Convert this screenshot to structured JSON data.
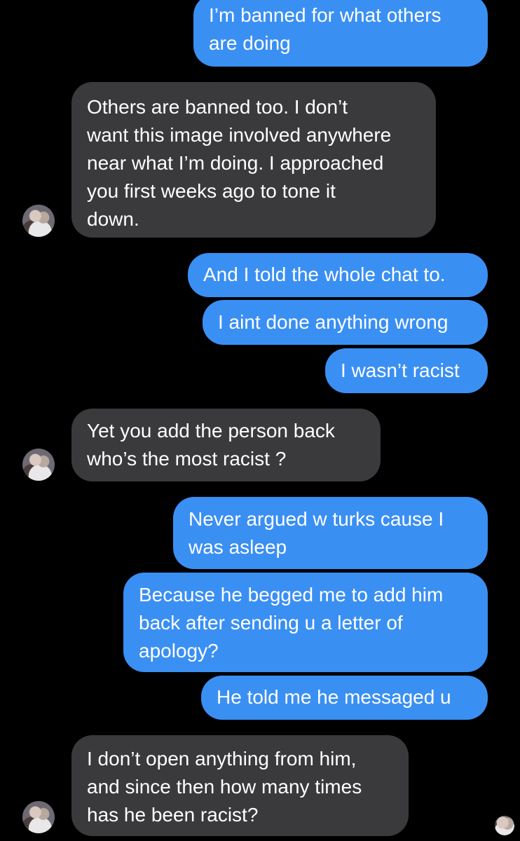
{
  "messages": [
    {
      "from": "me",
      "text": "I’m banned for what others\nare doing"
    },
    {
      "from": "them",
      "text": "Others are banned too. I don’t\nwant this image involved anywhere\nnear what I’m doing. I approached\nyou first weeks ago to tone it\ndown."
    },
    {
      "from": "me",
      "text": "And I told the whole chat to."
    },
    {
      "from": "me",
      "text": "I aint done anything wrong"
    },
    {
      "from": "me",
      "text": "I wasn’t racist"
    },
    {
      "from": "them",
      "text": "Yet you add the person back\nwho’s the most racist ?"
    },
    {
      "from": "me",
      "text": "Never argued w turks cause I\nwas asleep"
    },
    {
      "from": "me",
      "text": "Because he begged me to add him\nback after sending u a letter of\napology?"
    },
    {
      "from": "me",
      "text": "He told me he messaged u"
    },
    {
      "from": "them",
      "text": "I don’t open anything from him,\nand since then how many times\nhas he been racist?"
    }
  ],
  "colors": {
    "sent_bubble": "#3a8ff3",
    "received_bubble": "#3a3a3c",
    "background": "#000000"
  },
  "avatar": {
    "icon": "contact-avatar"
  }
}
